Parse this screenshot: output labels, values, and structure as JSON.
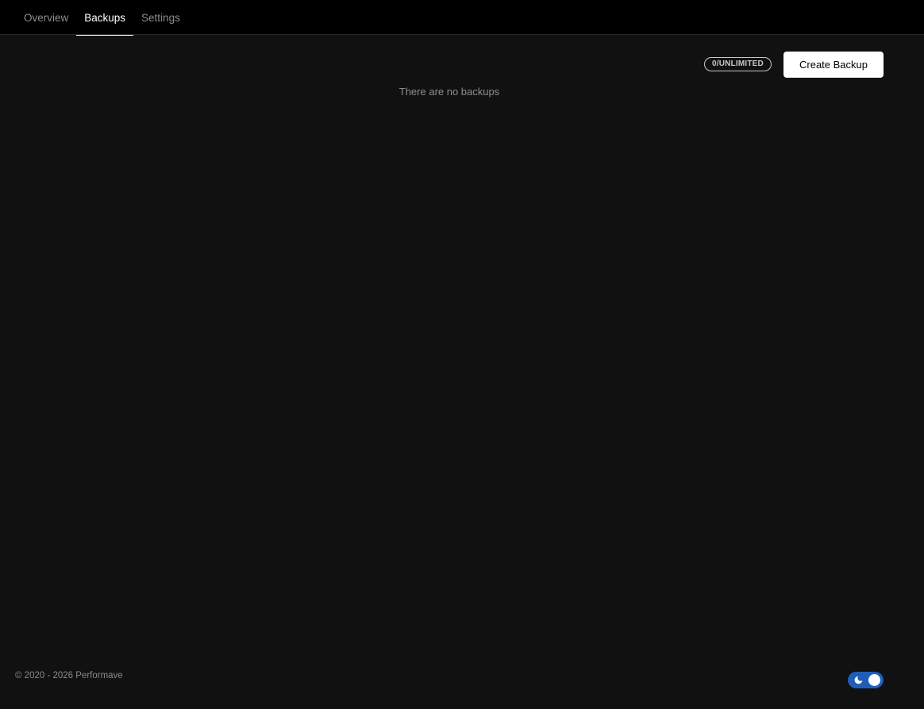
{
  "nav": {
    "tabs": [
      {
        "label": "Overview",
        "active": false
      },
      {
        "label": "Backups",
        "active": true
      },
      {
        "label": "Settings",
        "active": false
      }
    ]
  },
  "backups": {
    "quota_label": "0/UNLIMITED",
    "create_label": "Create Backup",
    "empty_message": "There are no backups"
  },
  "footer": {
    "copyright": "© 2020 - 2026 Performave"
  },
  "theme": {
    "mode": "dark",
    "toggle_color": "#1e5eb8",
    "icon": "moon-icon"
  }
}
